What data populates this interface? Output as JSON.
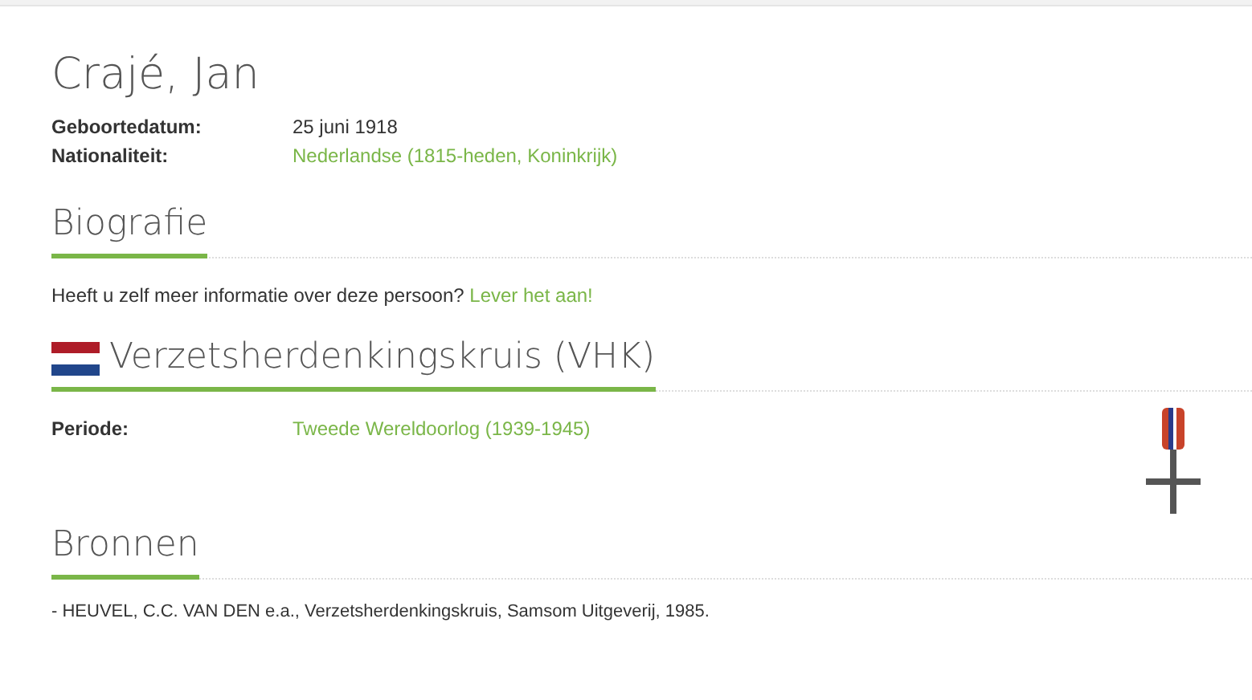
{
  "person": {
    "name": "Crajé, Jan",
    "details": [
      {
        "label": "Geboortedatum:",
        "value": "25 juni 1918",
        "kind": "text"
      },
      {
        "label": "Nationaliteit:",
        "value": "Nederlandse (1815-heden, Koninkrijk)",
        "kind": "link"
      }
    ]
  },
  "biography": {
    "heading": "Biografie",
    "text": "Heeft u zelf meer informatie over deze persoon?",
    "link": "Lever het aan!"
  },
  "award": {
    "heading": "Verzetsherdenkingskruis (VHK)",
    "details": [
      {
        "label": "Periode:",
        "value": "Tweede Wereldoorlog (1939-1945)",
        "kind": "link"
      }
    ]
  },
  "sources": {
    "heading": "Bronnen",
    "items": [
      "- HEUVEL, C.C. VAN DEN e.a., Verzetsherdenkingskruis, Samsom Uitgeverij, 1985."
    ]
  }
}
